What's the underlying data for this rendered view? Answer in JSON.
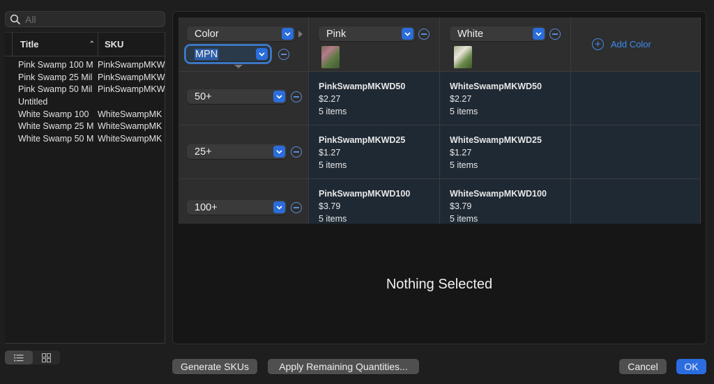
{
  "search": {
    "placeholder": "All"
  },
  "list": {
    "columns": {
      "title": "Title",
      "sku": "SKU"
    },
    "rows": [
      {
        "title": "Pink Swamp 100 M",
        "sku": "PinkSwampMKW"
      },
      {
        "title": "Pink Swamp 25 Mil",
        "sku": "PinkSwampMKW"
      },
      {
        "title": "Pink Swamp 50 Mil",
        "sku": "PinkSwampMKW"
      },
      {
        "title": "Untitled",
        "sku": ""
      },
      {
        "title": "White Swamp 100",
        "sku": "WhiteSwampMK"
      },
      {
        "title": "White Swamp 25 M",
        "sku": "WhiteSwampMK"
      },
      {
        "title": "White Swamp 50 M",
        "sku": "WhiteSwampMK"
      }
    ]
  },
  "matrix": {
    "row_attribute": "MPN",
    "column_attribute": "Color",
    "columns": [
      {
        "label": "Pink"
      },
      {
        "label": "White"
      }
    ],
    "add_column_label": "Add Color",
    "rows": [
      {
        "label": "50+",
        "cells": [
          {
            "sku": "PinkSwampMKWD50",
            "price": "$2.27",
            "qty": "5 items"
          },
          {
            "sku": "WhiteSwampMKWD50",
            "price": "$2.27",
            "qty": "5 items"
          }
        ]
      },
      {
        "label": "25+",
        "cells": [
          {
            "sku": "PinkSwampMKWD25",
            "price": "$1.27",
            "qty": "5 items"
          },
          {
            "sku": "WhiteSwampMKWD25",
            "price": "$1.27",
            "qty": "5 items"
          }
        ]
      },
      {
        "label": "100+",
        "cells": [
          {
            "sku": "PinkSwampMKWD100",
            "price": "$3.79",
            "qty": "5 items"
          },
          {
            "sku": "WhiteSwampMKWD100",
            "price": "$3.79",
            "qty": "5 items"
          }
        ]
      }
    ]
  },
  "detail": {
    "empty_text": "Nothing Selected"
  },
  "buttons": {
    "generate": "Generate SKUs",
    "apply": "Apply Remaining Quantities...",
    "cancel": "Cancel",
    "ok": "OK"
  },
  "colors": {
    "accent": "#2b6de0",
    "cell_bg": "#1f2934",
    "link": "#3d8cf0"
  }
}
